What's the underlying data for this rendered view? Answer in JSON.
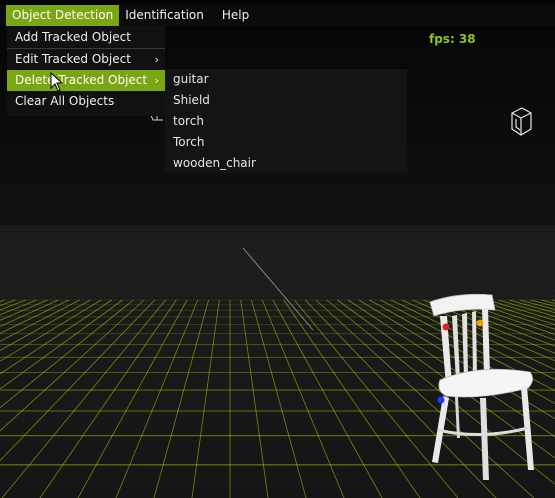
{
  "menubar": {
    "items": [
      {
        "label": "Object Detection",
        "active": true
      },
      {
        "label": "Identification",
        "active": false
      },
      {
        "label": "Help",
        "active": false
      }
    ]
  },
  "dropdown": {
    "items": [
      {
        "label": "Add Tracked Object",
        "submenu": false
      },
      {
        "label": "Edit Tracked Object",
        "submenu": true,
        "arrow": "›"
      },
      {
        "label": "Delete Tracked Object",
        "submenu": true,
        "arrow": "›",
        "highlighted": true
      },
      {
        "label": "Clear All Objects",
        "submenu": false
      }
    ]
  },
  "submenu": {
    "items": [
      "guitar",
      "Shield",
      "torch",
      "Torch",
      "wooden_chair"
    ]
  },
  "status": {
    "fps": "fps: 38"
  },
  "colors": {
    "accent": "#7aa614",
    "fps": "#8fc31f",
    "grid": "#c8e000",
    "background": "#000000"
  },
  "icons": [
    "cube-icon",
    "axis-icon",
    "cursor-icon"
  ]
}
